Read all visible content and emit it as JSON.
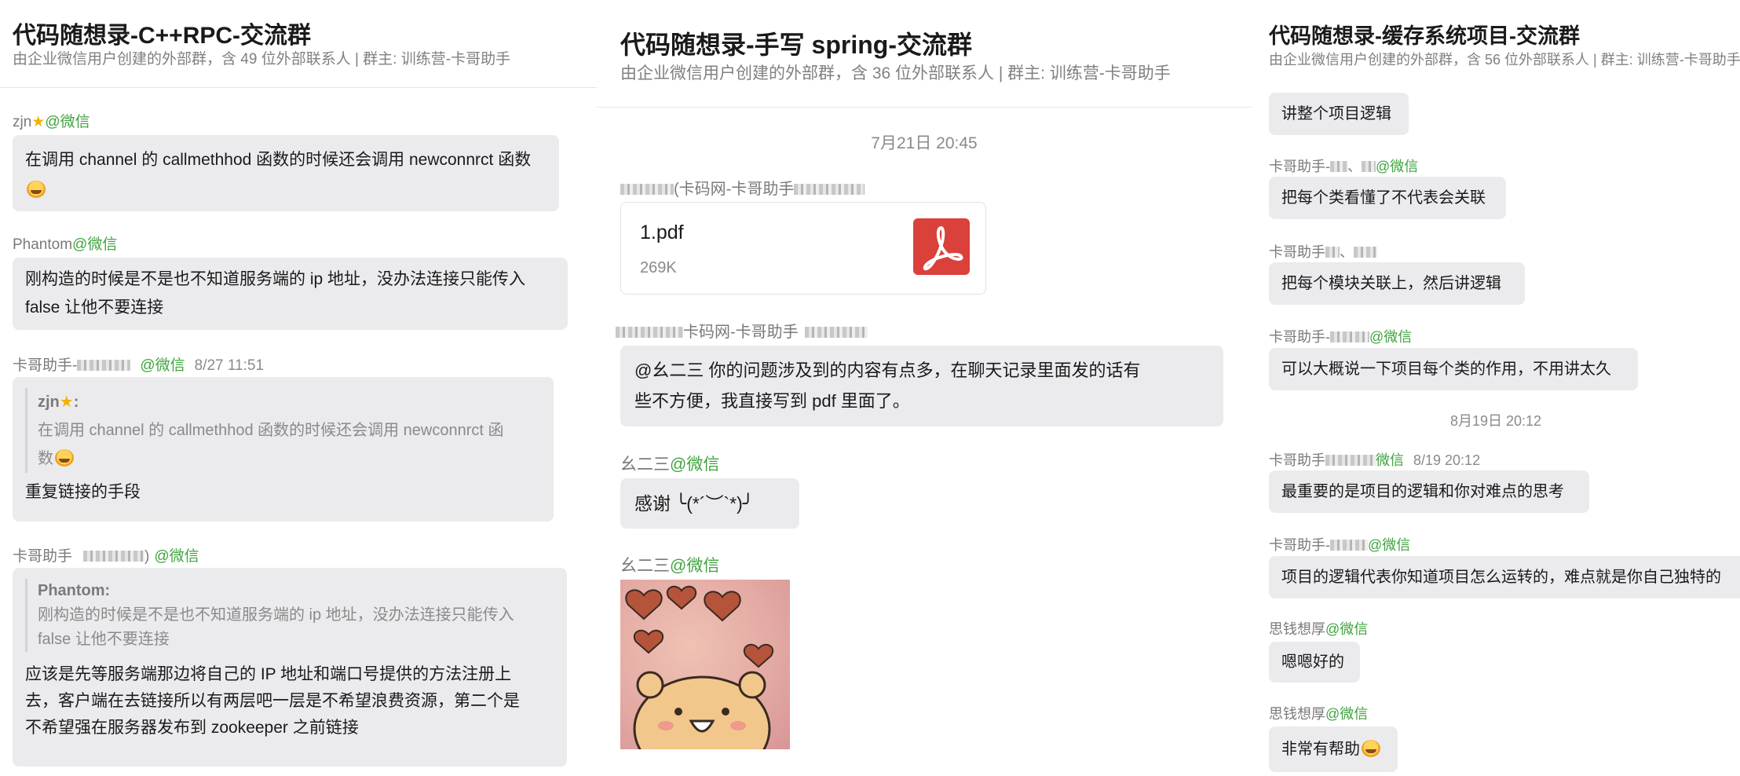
{
  "panel1": {
    "title": "代码随想录-C++RPC-交流群",
    "subtitle": "由企业微信用户创建的外部群，含 49 位外部联系人 | 群主: 训练营-卡哥助手",
    "messages": {
      "m1": {
        "name": "zjn",
        "wechat": "@微信",
        "text": "在调用 channel 的 callmethhod 函数的时候还会调用 newconnrct 函数"
      },
      "m2": {
        "name": "Phantom",
        "wechat": "@微信",
        "text1": "刚构造的时候是不是也不知道服务端的 ip 地址，没办法连接只能传入",
        "text2": "false 让他不要连接"
      },
      "m3": {
        "name": "卡哥助手-",
        "wechat": "@微信",
        "time": "8/27 11:51",
        "quote_name": "zjn",
        "quote_text1": "在调用 channel 的 callmethhod 函数的时候还会调用 newconnrct 函",
        "quote_text2": "数",
        "text": "重复链接的手段"
      },
      "m4": {
        "name": "卡哥助手",
        "name_tail": ")",
        "wechat": "@微信",
        "quote_name": "Phantom:",
        "quote_text1": "刚构造的时候是不是也不知道服务端的 ip 地址，没办法连接只能传入",
        "quote_text2": "false 让他不要连接",
        "text1": "应该是先等服务端那边将自己的 IP 地址和端口号提供的方法注册上",
        "text2": "去，客户端在去链接所以有两层吧一层是不希望浪费资源，第二个是",
        "text3": "不希望强在服务器发布到 zookeeper 之前链接"
      }
    }
  },
  "panel2": {
    "title": "代码随想录-手写 spring-交流群",
    "subtitle": "由企业微信用户创建的外部群，含 36 位外部联系人 | 群主: 训练营-卡哥助手",
    "date": "7月21日 20:45",
    "m1": {
      "name": "(卡码网-卡哥助手",
      "file_name": "1.pdf",
      "file_size": "269K"
    },
    "m2": {
      "name": "卡码网-卡哥助手",
      "text1": "@幺二三 你的问题涉及到的内容有点多，在聊天记录里面发的话有",
      "text2": "些不方便，我直接写到 pdf 里面了。"
    },
    "m3": {
      "name": "幺二三",
      "wechat": "@微信",
      "text": "感谢 ╰(*´︶`*)╯"
    },
    "m4": {
      "name": "幺二三",
      "wechat": "@微信"
    }
  },
  "panel3": {
    "title": "代码随想录-缓存系统项目-交流群",
    "subtitle": "由企业微信用户创建的外部群，含 56 位外部联系人 | 群主: 训练营-卡哥助手",
    "m0": {
      "text": "讲整个项目逻辑"
    },
    "m1": {
      "name": "卡哥助手-",
      "sep": "、",
      "wechat": "@微信",
      "text": "把每个类看懂了不代表会关联"
    },
    "m2": {
      "name": "卡哥助手",
      "sep": "、",
      "text": "把每个模块关联上，然后讲逻辑"
    },
    "m3": {
      "name": "卡哥助手-",
      "wechat": "@微信",
      "text": "可以大概说一下项目每个类的作用，不用讲太久"
    },
    "date": "8月19日 20:12",
    "m4": {
      "name": "卡哥助手",
      "wechat": "微信",
      "time": "8/19 20:12",
      "text": "最重要的是项目的逻辑和你对难点的思考"
    },
    "m5": {
      "name": "卡哥助手-",
      "wechat": "@微信",
      "text": "项目的逻辑代表你知道项目怎么运转的，难点就是你自己独特的"
    },
    "m6": {
      "name": "思钱想厚",
      "wechat": "@微信",
      "text": "嗯嗯好的"
    },
    "m7": {
      "name": "思钱想厚",
      "wechat": "@微信",
      "text": "非常有帮助"
    }
  },
  "colors": {
    "wechat_green": "#3fa33f",
    "bubble": "#ebebee",
    "pdf_red": "#d9413a"
  },
  "icons": [
    "star-icon",
    "grimace-emoji-icon",
    "pdf-file-icon",
    "heart-bear-sticker",
    "blush-emoji-icon"
  ]
}
